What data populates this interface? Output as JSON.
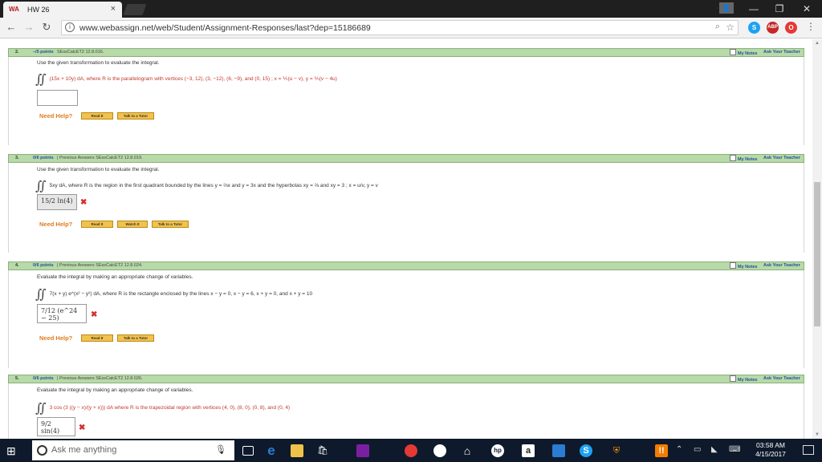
{
  "browser": {
    "tab_title": "HW 26",
    "tab_favicon": "WA",
    "url": "www.webassign.net/web/Student/Assignment-Responses/last?dep=15186689",
    "controls": {
      "minimize": "—",
      "maximize": "❐",
      "close": "✕"
    },
    "extensions": [
      "S",
      "ABP",
      "O"
    ]
  },
  "questions": [
    {
      "number": "2.",
      "points": "–/5 points",
      "meta": "SEssCalcET2 12.8.016.",
      "my_notes": "My Notes",
      "ask_teacher": "Ask Your Teacher",
      "prompt": "Use the given transformation to evaluate the integral.",
      "formula": "(15x + 10y) dA,  where R is the parallelogram with vertices  (−3, 12),  (3, −12),  (6, −9),  and  (0, 15) ;  x = ⅕(u − v),  y = ⅕(v − 4u)",
      "answer": "",
      "need_help": "Need Help?",
      "help_buttons": [
        "Read It",
        "Talk to a Tutor"
      ]
    },
    {
      "number": "3.",
      "points": "0/6 points",
      "meta": "|  Previous Answers   SEssCalcET2 12.8.019.",
      "my_notes": "My Notes",
      "ask_teacher": "Ask Your Teacher",
      "prompt": "Use the given transformation to evaluate the integral.",
      "formula": "5xy dA,  where R is the region in the first quadrant bounded by the lines  y = ⅔x  and  y = 3x  and the hyperbolas  xy = ⅔  and  xy = 3 ;  x = u/v,  y = v",
      "answer": "15/2 ln(4)",
      "need_help": "Need Help?",
      "help_buttons": [
        "Read It",
        "Watch It",
        "Talk to a Tutor"
      ]
    },
    {
      "number": "4.",
      "points": "0/6 points",
      "meta": "|  Previous Answers   SEssCalcET2 12.8.024.",
      "my_notes": "My Notes",
      "ask_teacher": "Ask Your Teacher",
      "prompt": "Evaluate the integral by making an appropriate change of variables.",
      "formula": "7(x + y) e^(x² − y²) dA,  where R is the rectangle enclosed by the lines  x − y = 0,  x − y = 6,  x + y = 0,  and  x + y = 10",
      "answer": "7/12 (e^24 − 25)",
      "need_help": "Need Help?",
      "help_buttons": [
        "Read It",
        "Talk to a Tutor"
      ]
    },
    {
      "number": "5.",
      "points": "0/6 points",
      "meta": "|  Previous Answers   SEssCalcET2 12.8.026.",
      "my_notes": "My Notes",
      "ask_teacher": "Ask Your Teacher",
      "prompt": "Evaluate the integral by making an appropriate change of variables.",
      "formula": "3 cos (3 ((y − x)/(y + x))) dA  where R is the trapezoidal region with vertices  (4, 0),  (8, 0),  (0, 8),  and  (0, 4)",
      "answer": "9/2 sin(4)",
      "need_help": "",
      "help_buttons": []
    }
  ],
  "taskbar": {
    "search_placeholder": "Ask me anything",
    "time": "03:58 AM",
    "date": "4/15/2017"
  }
}
